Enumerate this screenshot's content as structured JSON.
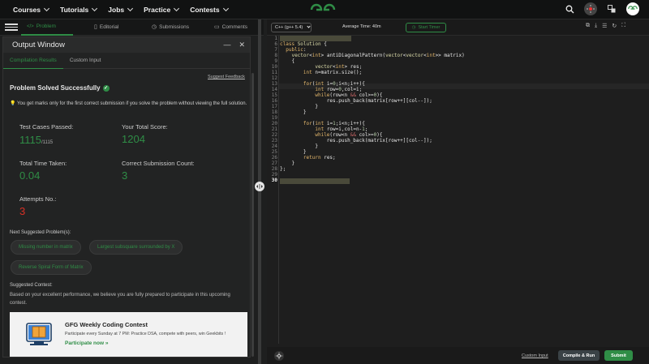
{
  "nav": {
    "menu": [
      "Courses",
      "Tutorials",
      "Jobs",
      "Practice",
      "Contests"
    ],
    "logo_text": "GG"
  },
  "tabs": {
    "problem": "Problem",
    "editorial": "Editorial",
    "submissions": "Submissions",
    "comments": "Comments"
  },
  "output": {
    "title": "Output Window",
    "tab_results": "Compilation Results",
    "tab_custom": "Custom Input",
    "feedback_link": "Suggest Feedback",
    "status": "Problem Solved Successfully",
    "note": "You get marks only for the first correct submission if you solve the problem without viewing the full solution.",
    "tests_label": "Test Cases Passed:",
    "tests_value": "1115",
    "tests_total": "/1115",
    "score_label": "Your Total Score:",
    "score_value": "1204",
    "time_label": "Total Time Taken:",
    "time_value": "0.04",
    "correct_label": "Correct Submission Count:",
    "correct_value": "3",
    "attempts_label": "Attempts No.:",
    "attempts_value": "3",
    "next_label": "Next Suggested Problem(s):",
    "suggested": [
      "Missing number in matrix",
      "Largest subsquare surrounded by X",
      "Reverse Spiral Form of Matrix"
    ],
    "contest_label": "Suggested Contest:",
    "contest_note": "Based on your excellent performance, we believe you are fully prepared to participate in this upcoming contest.",
    "contest_title": "GFG Weekly Coding Contest",
    "contest_desc": "Participate every Sunday at 7 PM: Practice DSA, compete with peers, win Geekbits !",
    "contest_link": "Participate now »"
  },
  "editor": {
    "language": "C++ (g++ 5.4)",
    "avg_time": "Average Time: 40m",
    "timer_label": "Start Timer",
    "line_numbers": [
      "1",
      "6",
      "7",
      "8",
      "9",
      "10",
      "11",
      "12",
      "13",
      "14",
      "15",
      "16",
      "17",
      "18",
      "19",
      "20",
      "21",
      "22",
      "23",
      "24",
      "25",
      "26",
      "27",
      "28",
      "29",
      "30"
    ],
    "custom_input": "Custom Input",
    "compile_run": "Compile & Run",
    "submit": "Submit"
  },
  "colors": {
    "accent": "#2f8d46",
    "attempts": "#d93025"
  }
}
